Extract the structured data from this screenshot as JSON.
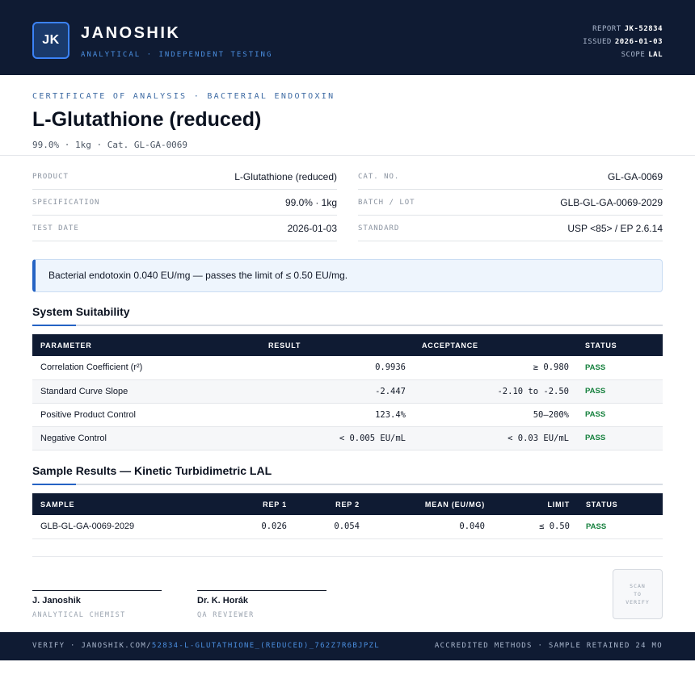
{
  "brand": {
    "logo_text": "JK",
    "name": "JANOSHIK",
    "tagline": "ANALYTICAL · INDEPENDENT TESTING"
  },
  "report": {
    "report_label": "REPORT",
    "report_value": "JK-52834",
    "issued_label": "ISSUED",
    "issued_value": "2026-01-03",
    "scope_label": "SCOPE",
    "scope_value": "LAL"
  },
  "certificate": {
    "label": "CERTIFICATE OF ANALYSIS · BACTERIAL ENDOTOXIN",
    "title": "L-Glutathione (reduced)",
    "subtitle": "99.0% · 1kg  ·  Cat. GL-GA-0069"
  },
  "info": {
    "left": [
      {
        "key": "PRODUCT",
        "value": "L-Glutathione (reduced)"
      },
      {
        "key": "SPECIFICATION",
        "value": "99.0% · 1kg"
      },
      {
        "key": "TEST DATE",
        "value": "2026-01-03"
      }
    ],
    "right": [
      {
        "key": "CAT. NO.",
        "value": "GL-GA-0069"
      },
      {
        "key": "BATCH / LOT",
        "value": "GLB-GL-GA-0069-2029"
      },
      {
        "key": "STANDARD",
        "value": "USP <85> / EP 2.6.14"
      }
    ]
  },
  "notice": "Bacterial endotoxin 0.040 EU/mg — passes the limit of ≤ 0.50 EU/mg.",
  "system_suitability": {
    "title": "System Suitability",
    "headers": [
      "PARAMETER",
      "RESULT",
      "ACCEPTANCE",
      "STATUS"
    ],
    "rows": [
      {
        "parameter": "Correlation Coefficient (r²)",
        "result": "0.9936",
        "acceptance": "≥ 0.980",
        "status": "PASS"
      },
      {
        "parameter": "Standard Curve Slope",
        "result": "-2.447",
        "acceptance": "-2.10 to -2.50",
        "status": "PASS"
      },
      {
        "parameter": "Positive Product Control",
        "result": "123.4%",
        "acceptance": "50–200%",
        "status": "PASS"
      },
      {
        "parameter": "Negative Control",
        "result": "< 0.005 EU/mL",
        "acceptance": "< 0.03 EU/mL",
        "status": "PASS"
      }
    ]
  },
  "sample_results": {
    "title": "Sample Results — Kinetic Turbidimetric LAL",
    "headers": [
      "SAMPLE",
      "REP 1",
      "REP 2",
      "MEAN (EU/MG)",
      "LIMIT",
      "STATUS"
    ],
    "rows": [
      {
        "sample": "GLB-GL-GA-0069-2029",
        "rep1": "0.026",
        "rep2": "0.054",
        "mean": "0.040",
        "limit": "≤ 0.50",
        "status": "PASS"
      }
    ]
  },
  "signatures": [
    {
      "name": "J. Janoshik",
      "role": "ANALYTICAL CHEMIST"
    },
    {
      "name": "Dr. K. Horák",
      "role": "QA REVIEWER"
    }
  ],
  "qr_text": [
    "SCAN",
    "TO",
    "VERIFY"
  ],
  "footer": {
    "verify_prefix": "VERIFY · JANOSHIK.COM/",
    "verify_link": "52834-L-GLUTATHIONE_(REDUCED)_762Z7R6BJPZL",
    "right_text": "ACCREDITED METHODS · SAMPLE RETAINED 24 MO"
  },
  "colors": {
    "navy": "#0f1b33",
    "accent": "#2563c4",
    "pass": "#15803d"
  }
}
